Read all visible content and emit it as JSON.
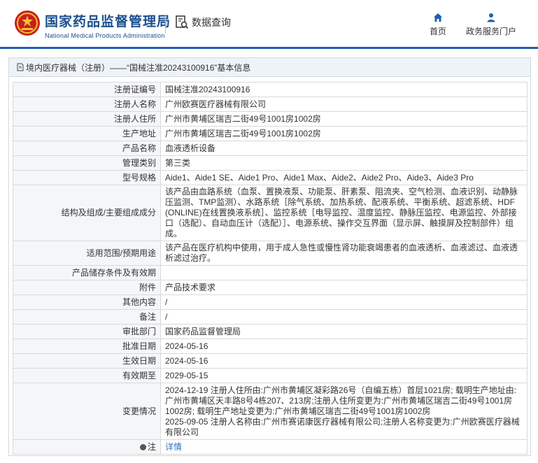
{
  "header": {
    "brand_cn": "国家药品监督管理局",
    "brand_en": "National Medical Products Administration",
    "data_query": "数据查询",
    "nav": {
      "home": "首页",
      "service": "政务服务门户"
    },
    "colors": {
      "brand": "#1a4f8f",
      "accent": "#1f5fa8",
      "emblem_red": "#c8201d",
      "emblem_gold": "#f1c232"
    }
  },
  "breadcrumb": {
    "text": "境内医疗器械（注册）——“国械注准20243100916”基本信息"
  },
  "record": {
    "rows": [
      {
        "label": "注册证编号",
        "value": "国械注准20243100916"
      },
      {
        "label": "注册人名称",
        "value": "广州欧赛医疗器械有限公司"
      },
      {
        "label": "注册人住所",
        "value": "广州市黄埔区瑞吉二街49号1001房1002房"
      },
      {
        "label": "生产地址",
        "value": "广州市黄埔区瑞吉二街49号1001房1002房"
      },
      {
        "label": "产品名称",
        "value": "血液透析设备"
      },
      {
        "label": "管理类别",
        "value": "第三类"
      },
      {
        "label": "型号规格",
        "value": "Aide1、Aide1 SE、Aide1 Pro、Aide1 Max、Aide2、Aide2 Pro、Aide3、Aide3 Pro"
      },
      {
        "label": "结构及组成/主要组成成分",
        "value": "该产品由血路系统（血泵、置换液泵、功能泵、肝素泵、阻流夹、空气检测、血液识别、动静脉压监测、TMP监测）、水路系统［除气系统、加热系统、配液系统、平衡系统、超滤系统、HDF (ONLINE)在线置换液系统］、监控系统［电导监控、温度监控、静脉压监控、电源监控、外部接口（选配）、自动血压计（选配）］、电源系统、操作交互界面（显示屏、触摸屏及控制部件）组成。"
      },
      {
        "label": "适用范围/预期用途",
        "value": "该产品在医疗机构中使用，用于成人急性或慢性肾功能衰竭患者的血液透析、血液滤过、血液透析滤过治疗。"
      },
      {
        "label": "产品储存条件及有效期",
        "value": ""
      },
      {
        "label": "附件",
        "value": "产品技术要求"
      },
      {
        "label": "其他内容",
        "value": "/"
      },
      {
        "label": "备注",
        "value": "/"
      },
      {
        "label": "审批部门",
        "value": "国家药品监督管理局"
      },
      {
        "label": "批准日期",
        "value": "2024-05-16"
      },
      {
        "label": "生效日期",
        "value": "2024-05-16"
      },
      {
        "label": "有效期至",
        "value": "2029-05-15"
      },
      {
        "label": "变更情况",
        "value": "2024-12-19 注册人住所由:广州市黄埔区凝彩路26号（自编五栋）首层1021房; 载明生产地址由:广州市黄埔区天丰路8号4栋207、213房;注册人住所变更为:广州市黄埔区瑞吉二街49号1001房1002房; 载明生产地址变更为:广州市黄埔区瑞吉二街49号1001房1002房\n2025-09-05 注册人名称由:广州市赛诺康医疗器械有限公司;注册人名称变更为:广州欧赛医疗器械有限公司"
      },
      {
        "label": "注",
        "value": "详情"
      }
    ]
  }
}
